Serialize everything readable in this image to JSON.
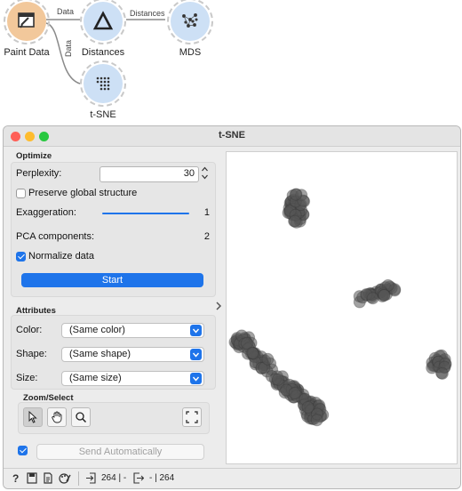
{
  "workflow": {
    "nodes": [
      {
        "name": "Paint Data"
      },
      {
        "name": "Distances"
      },
      {
        "name": "MDS"
      },
      {
        "name": "t-SNE"
      }
    ],
    "links": {
      "paint_to_distances": "Data",
      "distances_to_mds": "Distances",
      "paint_to_tsne": "Data"
    }
  },
  "window": {
    "title": "t-SNE"
  },
  "optimize": {
    "group_title": "Optimize",
    "perplexity_label": "Perplexity:",
    "perplexity_value": "30",
    "preserve_label": "Preserve global structure",
    "preserve_checked": false,
    "exaggeration_label": "Exaggeration:",
    "exaggeration_value": "1",
    "pca_label": "PCA components:",
    "pca_value": "2",
    "normalize_label": "Normalize data",
    "normalize_checked": true,
    "start_label": "Start"
  },
  "attributes": {
    "group_title": "Attributes",
    "color_label": "Color:",
    "color_value": "(Same color)",
    "shape_label": "Shape:",
    "shape_value": "(Same shape)",
    "size_label": "Size:",
    "size_value": "(Same size)"
  },
  "zoom": {
    "group_title": "Zoom/Select"
  },
  "send": {
    "label": "Send Automatically",
    "checked": true
  },
  "status": {
    "input_count": "264 | -",
    "output_count": "- | 264"
  },
  "colors": {
    "accent": "#1e74ea",
    "node_paint": "#f2c89b",
    "node_blue": "#cde0f5",
    "point": "#555555"
  }
}
